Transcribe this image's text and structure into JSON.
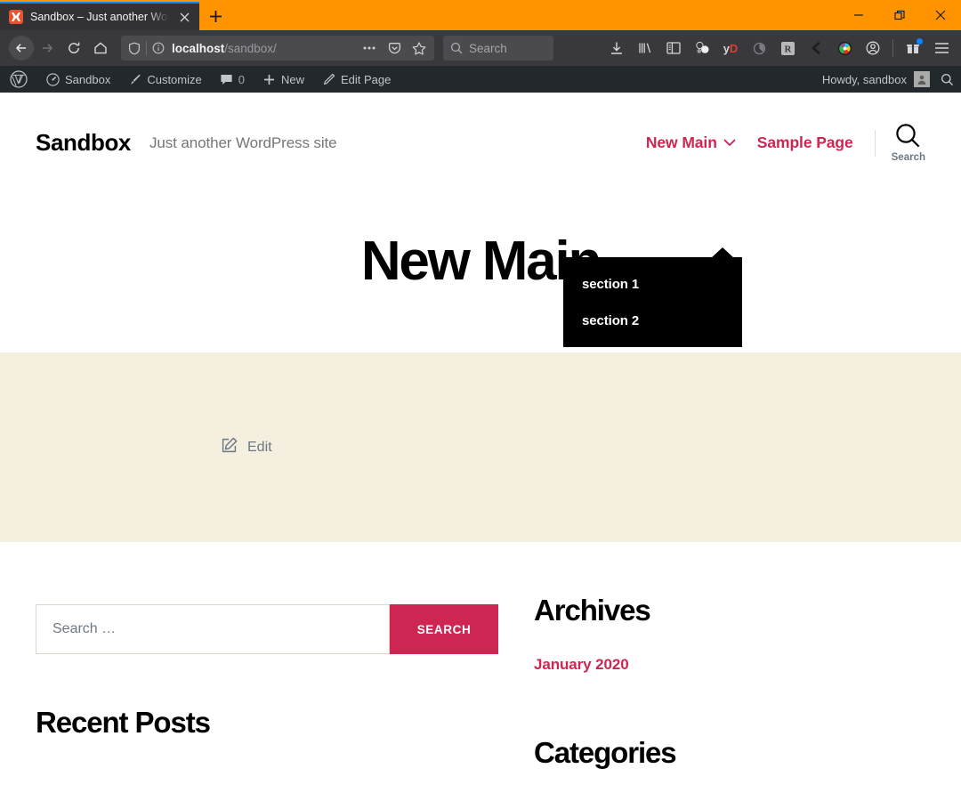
{
  "browser": {
    "tab": {
      "title": "Sandbox – Just another WordPr",
      "favicon_icon": "wordpress-favicon-icon",
      "close_icon": "close-icon"
    },
    "new_tab_icon": "plus-icon",
    "window_controls": [
      {
        "name": "minimize-button",
        "icon": "minimize-icon"
      },
      {
        "name": "maximize-button",
        "icon": "maximize-icon"
      },
      {
        "name": "close-window-button",
        "icon": "close-icon"
      }
    ],
    "nav": {
      "back_icon": "back-arrow-icon",
      "forward_icon": "forward-arrow-icon",
      "reload_icon": "reload-icon",
      "home_icon": "home-icon"
    },
    "urlbar": {
      "shield_icon": "shield-icon",
      "info_icon": "page-info-icon",
      "host": "localhost",
      "path": "/sandbox/",
      "actions": [
        {
          "name": "page-actions-button",
          "icon": "ellipsis-icon"
        },
        {
          "name": "pocket-button",
          "icon": "pocket-icon"
        },
        {
          "name": "bookmark-button",
          "icon": "star-icon"
        }
      ]
    },
    "search": {
      "placeholder": "Search",
      "icon": "search-icon"
    },
    "toolbar_icons": [
      {
        "name": "downloads-button",
        "icon": "download-icon"
      },
      {
        "name": "library-button",
        "icon": "library-icon"
      },
      {
        "name": "sidebar-button",
        "icon": "sidebar-icon"
      },
      {
        "name": "extension-molecule-button",
        "icon": "molecule-icon"
      },
      {
        "name": "youtube-downloader-button",
        "icon": "yd-icon",
        "label": "yD"
      },
      {
        "name": "extension-circle-button",
        "icon": "circle-arc-icon"
      },
      {
        "name": "extension-r-button",
        "icon": "r-box-icon"
      },
      {
        "name": "extension-chevron-button",
        "icon": "chevron-left-icon"
      },
      {
        "name": "extension-color-button",
        "icon": "color-wheel-icon"
      },
      {
        "name": "account-button",
        "icon": "account-icon"
      },
      {
        "name": "extension-gift-button",
        "icon": "gift-icon",
        "badge": true
      },
      {
        "name": "app-menu-button",
        "icon": "hamburger-menu-icon"
      }
    ]
  },
  "adminbar": {
    "logo_icon": "wordpress-logo-icon",
    "items": [
      {
        "label": "Sandbox",
        "icon": "dashboard-icon"
      },
      {
        "label": "Customize",
        "icon": "paintbrush-icon"
      },
      {
        "label": "0",
        "icon": "comment-bubble-icon"
      },
      {
        "label": "New",
        "icon": "plus-icon"
      },
      {
        "label": "Edit Page",
        "icon": "pencil-icon"
      }
    ],
    "howdy": "Howdy, sandbox",
    "avatar_icon": "avatar-icon",
    "search_icon": "search-icon"
  },
  "site": {
    "title": "Sandbox",
    "description": "Just another WordPress site",
    "nav": [
      {
        "label": "New Main",
        "has_submenu": true,
        "chevron_icon": "chevron-down-icon"
      },
      {
        "label": "Sample Page",
        "has_submenu": false
      }
    ],
    "submenu": [
      {
        "label": "section 1"
      },
      {
        "label": "section 2"
      }
    ],
    "search_button": {
      "label": "Search",
      "icon": "search-icon"
    },
    "entry_title": "New Main",
    "featured": {
      "edit_label": "Edit",
      "edit_icon": "edit-square-pencil-icon",
      "background": "#f5efe0"
    }
  },
  "widgets": {
    "search": {
      "placeholder": "Search …",
      "value": "",
      "submit_label": "SEARCH"
    },
    "recent_posts_title": "Recent Posts",
    "archives_title": "Archives",
    "archives_links": [
      {
        "label": "January 2020"
      }
    ],
    "categories_title": "Categories"
  },
  "colors": {
    "accent": "#cd2653",
    "browser_accent": "#ff9400",
    "admin_bar": "#23282d",
    "featured_bg": "#f5efe0",
    "muted_text": "#6d7882"
  }
}
